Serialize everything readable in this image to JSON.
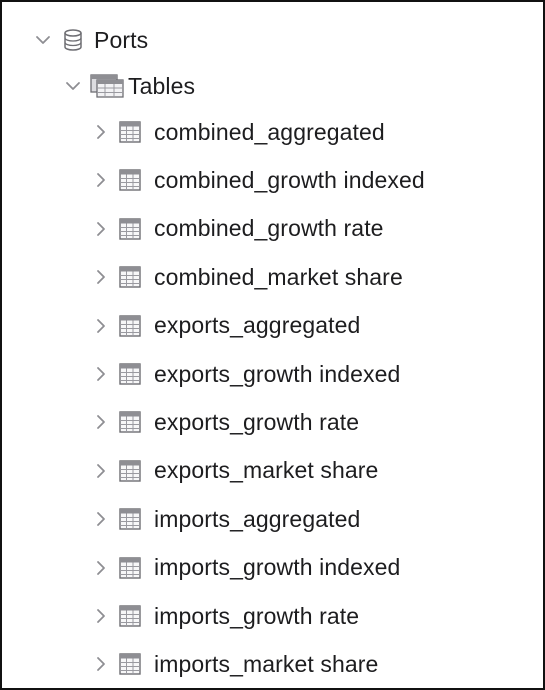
{
  "tree": {
    "database": {
      "label": "Ports",
      "icon": "database-icon",
      "expanded": true
    },
    "folder": {
      "label": "Tables",
      "icon": "tables-folder-icon",
      "expanded": true
    },
    "tables": [
      {
        "label": "combined_aggregated",
        "icon": "table-icon",
        "expanded": false
      },
      {
        "label": "combined_growth indexed",
        "icon": "table-icon",
        "expanded": false
      },
      {
        "label": "combined_growth rate",
        "icon": "table-icon",
        "expanded": false
      },
      {
        "label": "combined_market share",
        "icon": "table-icon",
        "expanded": false
      },
      {
        "label": "exports_aggregated",
        "icon": "table-icon",
        "expanded": false
      },
      {
        "label": "exports_growth indexed",
        "icon": "table-icon",
        "expanded": false
      },
      {
        "label": "exports_growth rate",
        "icon": "table-icon",
        "expanded": false
      },
      {
        "label": "exports_market share",
        "icon": "table-icon",
        "expanded": false
      },
      {
        "label": "imports_aggregated",
        "icon": "table-icon",
        "expanded": false
      },
      {
        "label": "imports_growth indexed",
        "icon": "table-icon",
        "expanded": false
      },
      {
        "label": "imports_growth rate",
        "icon": "table-icon",
        "expanded": false
      },
      {
        "label": "imports_market share",
        "icon": "table-icon",
        "expanded": false
      }
    ]
  },
  "colors": {
    "text": "#1d1d1f",
    "chevron": "#8e8e93",
    "icon_stroke": "#6e6e73",
    "border": "#111111"
  }
}
